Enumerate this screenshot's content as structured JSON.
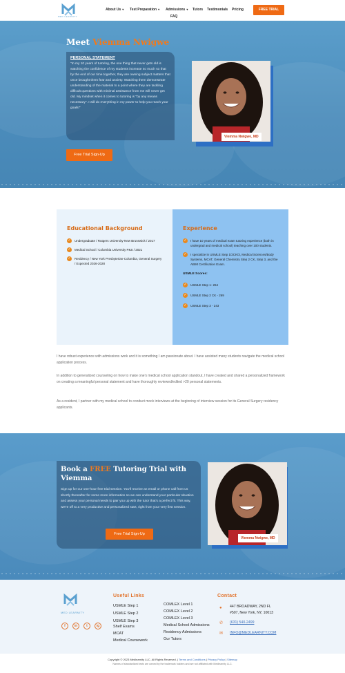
{
  "nav": {
    "logo_text": "MED LEARNITY",
    "items": [
      {
        "label": "About Us",
        "dropdown": true
      },
      {
        "label": "Test Preparation",
        "dropdown": true
      },
      {
        "label": "Admissions",
        "dropdown": true
      },
      {
        "label": "Tutors",
        "dropdown": false
      },
      {
        "label": "Testimonials",
        "dropdown": false
      },
      {
        "label": "Pricing",
        "dropdown": false
      },
      {
        "label": "FAQ",
        "dropdown": false
      }
    ],
    "cta": "FREE TRIAL"
  },
  "hero": {
    "meet": "Meet",
    "name": "Viemma Nwigwe",
    "statement_title": "PERSONAL STATEMENT",
    "statement": "\"In my 10 years of tutoring, the one thing that never gets old is watching the confidence of my students increase so much so that by the end of our time together, they are owning subject matters that once brought them fear and anxiety. Watching them demonstrate understanding of the material to a point where they are tackling difficult questions with minimal assistance from me will never get old. My mindset when it comes to tutoring is \"by any means necessary\". I will do everything in my power to help you reach your goals!\"",
    "signup_button": "Free Trial Sign-Up",
    "photo_caption": "Viemma Nwigwe, MD"
  },
  "education": {
    "heading": "Educational Background",
    "items": [
      "Undergraduate / Rutgers University-New Brunswick / 2017",
      "Medical School / Columbia University P&S / 2021",
      "Residency / New York Presbyterian-Columbia, General Surgery / Expected 2026-2028"
    ]
  },
  "experience": {
    "heading": "Experience",
    "items": [
      "I have 10 years of medical exam tutoring experience (both in undergrad and medical school) teaching over 100 students.",
      "I specialize in USMLE Step 1/2CK/3, Medical Sciences/Body Systems, MCAT, General Chemistry Step 2 CK, Step 3, and the ABIM Certification Exam."
    ],
    "scores_heading": "USMLE Scores:",
    "scores": [
      "USMLE Step 1- 264",
      "USMLE Step 2 CK - 269",
      "USMLE Step 3 - 243"
    ]
  },
  "paragraphs": [
    "I have robust experience with admissions work and it is something I am passionate about. I have assisted many students navigate the medical school application process.",
    "In addition to generalized counseling on how to make one's medical school application standout, I have created and shared a personalized framework on creating a meaningful personal statement and have thoroughly reviewed/edited >20 personal statements.",
    "As a resident, I partner with my medical school to conduct mock interviews at the beginning of interview session for its General Surgery residency applicants."
  ],
  "cta": {
    "heading_pre": "Book a ",
    "heading_free": "FREE",
    "heading_post": " Tutoring Trial with Viemma",
    "body": "Sign up for our one-hour free trial session. You'll receive an email or phone call from us shortly thereafter for some more information so we can understand your particular situation and assess your personal needs to pair you up with the tutor that's a perfect fit. This way, we're off to a very productive and personalized start, right from your very first session.",
    "button": "Free Trial Sign-Up",
    "photo_caption": "Viemma Nwigwe, MD"
  },
  "footer": {
    "logo_text": "MED LEARNITY",
    "useful_links_heading": "Useful Links",
    "links_col1": [
      "USMLE Step 1",
      "USMLE Step 2",
      "USMLE Step 3",
      "Shelf Exams",
      "MCAT",
      "Medical Coursework"
    ],
    "links_col2": [
      "COMLEX Level 1",
      "COMLEX Level 2",
      "COMLEX Level 3",
      "Medical School Admissions",
      "Residency Admissions",
      "Our Tutors"
    ],
    "contact_heading": "Contact",
    "address_line1": "447 BROADWAY, 2ND FL",
    "address_line2": "#507, New York, NY, 10013",
    "phone": "(631) 540-2499",
    "email": "INFO@MEDLEARNITY.COM",
    "social": [
      "f",
      "in",
      "t",
      "ig"
    ]
  },
  "bottom": {
    "copyright": "Copyright © 2023 Medlearnity LLC. All Rights Reserved.",
    "terms": "Terms and Conditions",
    "privacy": "Privacy Policy",
    "sitemap": "Sitemap",
    "disclaimer": "Names of standardized tests are owned by the trademark holders and are not affiliated with Medlearnity LLC."
  },
  "colors": {
    "accent": "#ef6a14",
    "hero_blue": "#4b8cbb",
    "exp_blue": "#8ec2f1"
  }
}
